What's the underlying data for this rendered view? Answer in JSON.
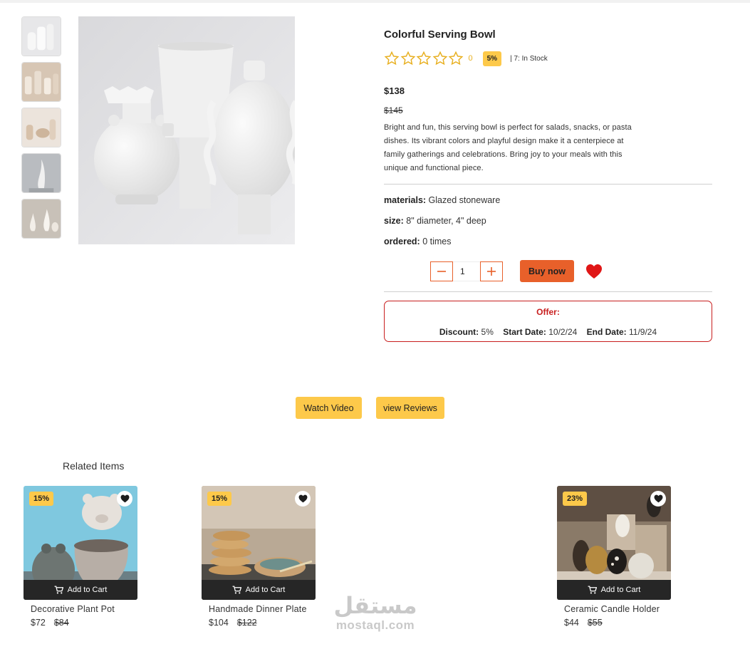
{
  "product": {
    "title": "Colorful Serving Bowl",
    "rating_count": "0",
    "discount_badge": "5%",
    "stock": "|  7: In Stock",
    "price": "$138",
    "old_price": "$145",
    "description": "Bright and fun, this serving bowl is perfect for salads, snacks, or pasta dishes. Its vibrant colors and playful design make it a centerpiece at family gatherings and celebrations. Bring joy to your meals with this unique and functional piece.",
    "attributes": [
      {
        "label": "materials:",
        "value": "Glazed stoneware"
      },
      {
        "label": "size:",
        "value": "8\" diameter, 4\" deep"
      },
      {
        "label": "ordered:",
        "value": "0 times"
      }
    ],
    "quantity": "1",
    "buy_label": "Buy now",
    "rating_stars": 0
  },
  "offer": {
    "title": "Offer:",
    "discount_label": "Discount:",
    "discount_value": "5%",
    "start_label": "Start Date:",
    "start_value": "10/2/24",
    "end_label": "End Date:",
    "end_value": "11/9/24"
  },
  "actions": {
    "watch_video": "Watch Video",
    "view_reviews": "view Reviews"
  },
  "related": {
    "title": "Related Items",
    "add_to_cart": "Add to Cart",
    "items": [
      {
        "badge": "15%",
        "name": "Decorative Plant Pot",
        "price": "$72",
        "old_price": "$84"
      },
      {
        "badge": "15%",
        "name": "Handmade Dinner Plate",
        "price": "$104",
        "old_price": "$122"
      },
      {
        "badge": "23%",
        "name": "Ceramic Candle Holder",
        "price": "$44",
        "old_price": "$55"
      }
    ]
  },
  "watermark": {
    "arabic": "مستقل",
    "latin": "mostaql.com"
  },
  "colors": {
    "accent": "#e8602a",
    "badge": "#fdc94a",
    "offer_border": "#c81e1e",
    "star": "#e8b021",
    "heart": "#e01616"
  },
  "icons": [
    "star-icon",
    "minus-icon",
    "plus-icon",
    "heart-icon",
    "cart-icon"
  ]
}
